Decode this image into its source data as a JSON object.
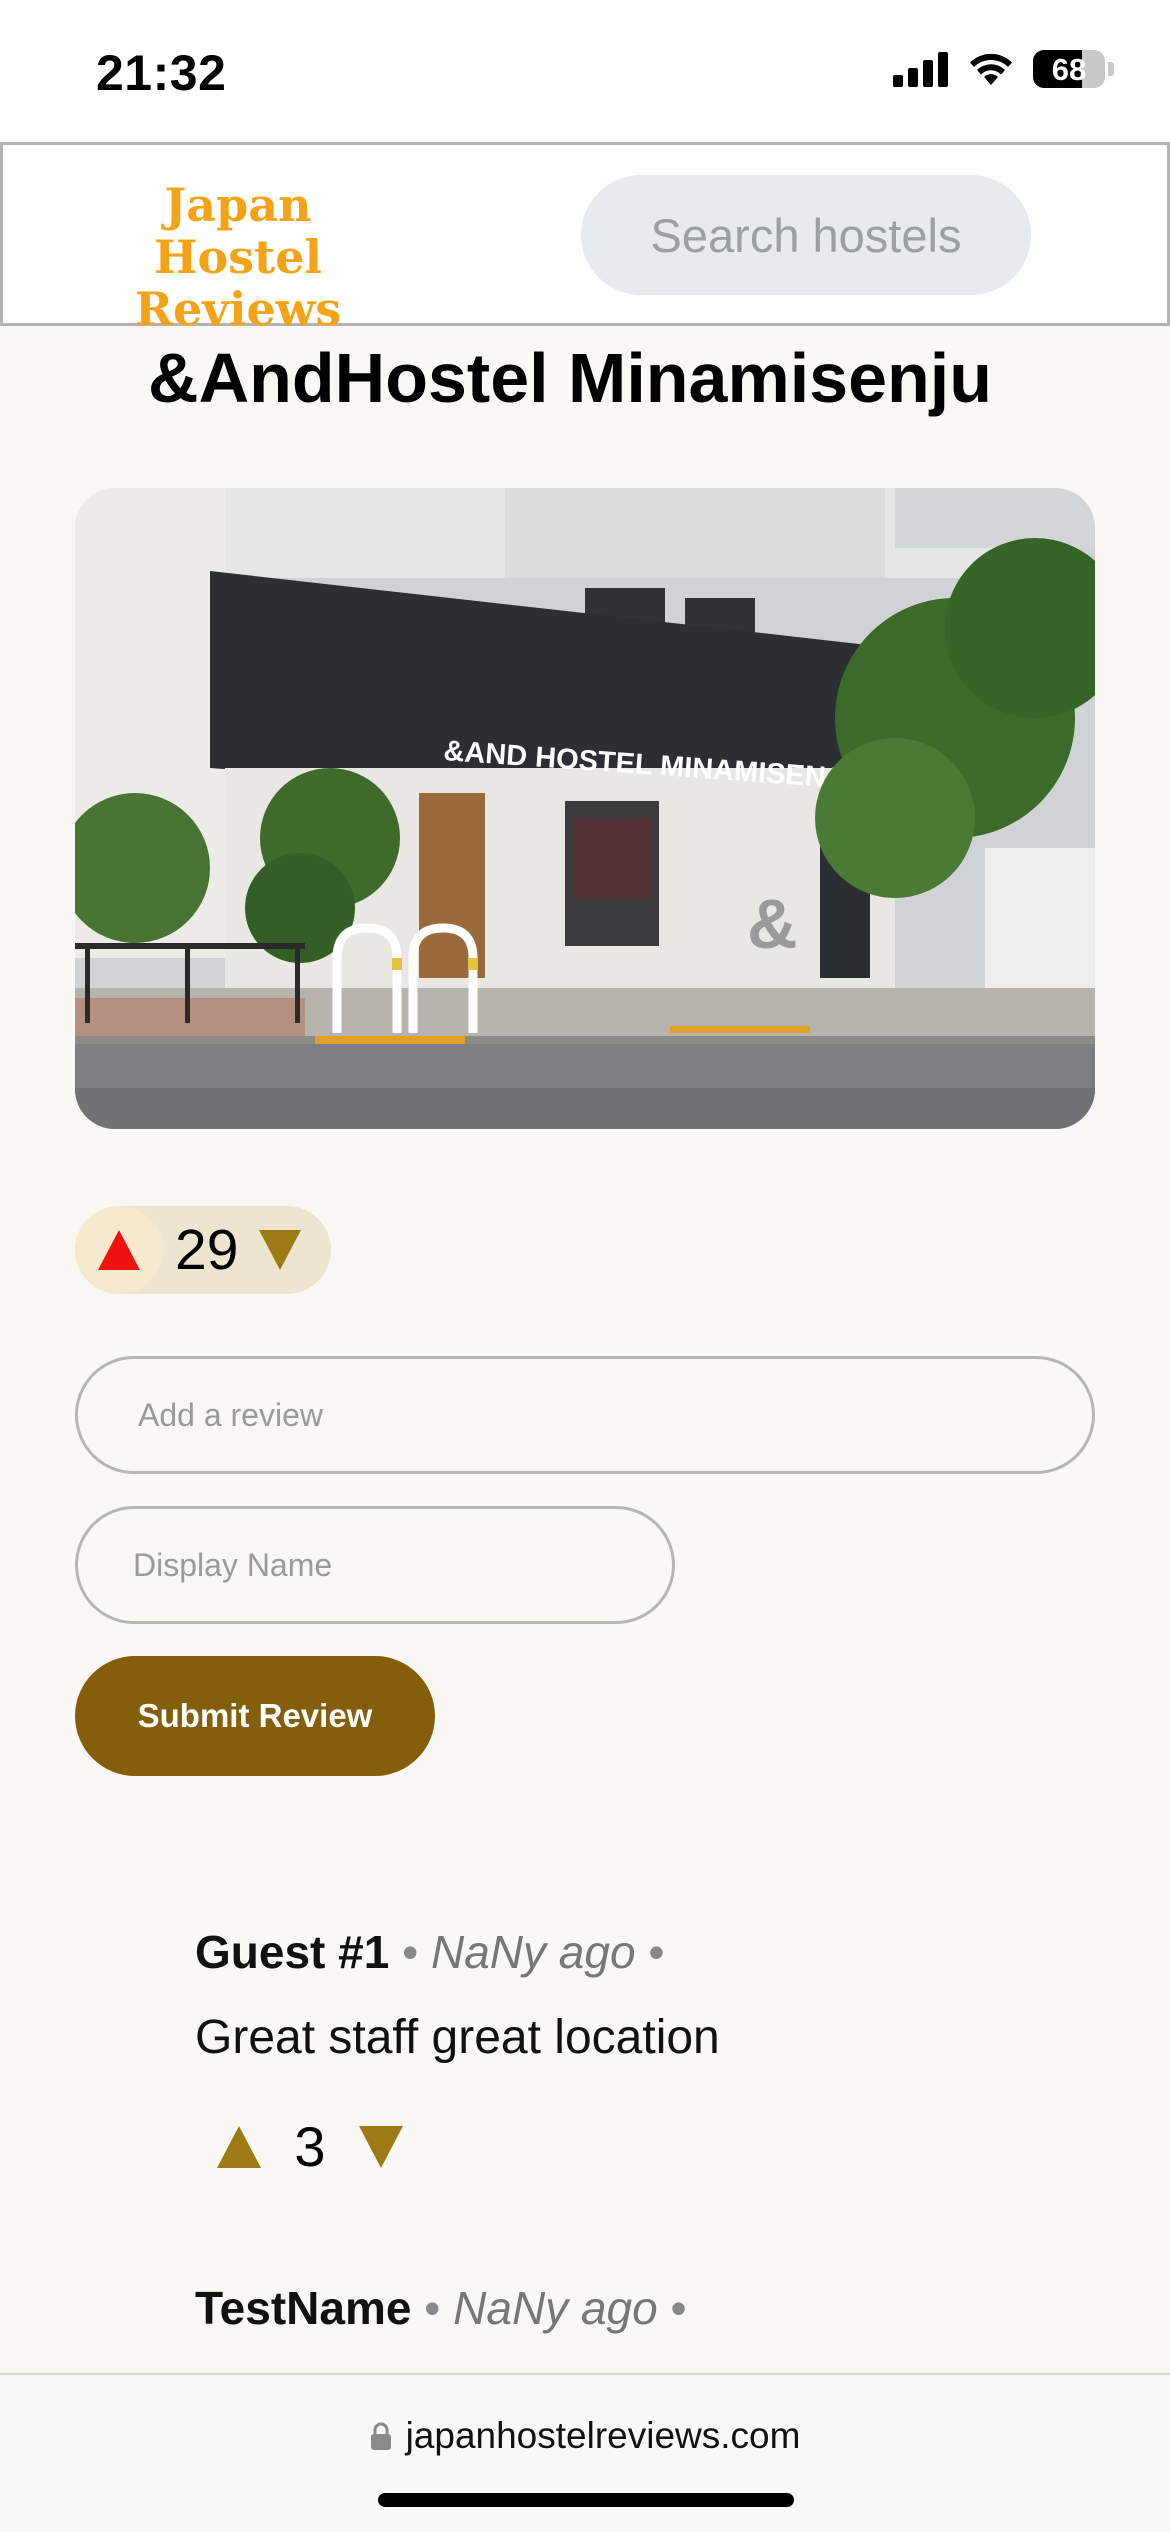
{
  "status_bar": {
    "time": "21:32",
    "battery": "68",
    "battery_level": 0.68,
    "icons": [
      "cellular-signal-icon",
      "wifi-icon",
      "battery-icon"
    ]
  },
  "header": {
    "logo_line1": "Japan",
    "logo_line2": "Hostel Reviews",
    "logo_color": "#f5a316",
    "search_placeholder": "Search hostels"
  },
  "hostel": {
    "title": "&AndHostel Minamisenju",
    "photo_sign": "&AND HOSTEL MINAMISENJU",
    "photo_ampersand": "&",
    "votes": "29"
  },
  "review_form": {
    "review_placeholder": "Add a review",
    "name_placeholder": "Display Name",
    "submit_label": "Submit Review",
    "accent_color": "#835f0c"
  },
  "reviews": [
    {
      "author": "Guest #1",
      "separator": "•",
      "time": "NaNy ago",
      "text": "Great staff great location",
      "votes": "3"
    },
    {
      "author": "TestName",
      "separator": "•",
      "time": "NaNy ago"
    }
  ],
  "browser": {
    "url": "japanhostelreviews.com"
  }
}
